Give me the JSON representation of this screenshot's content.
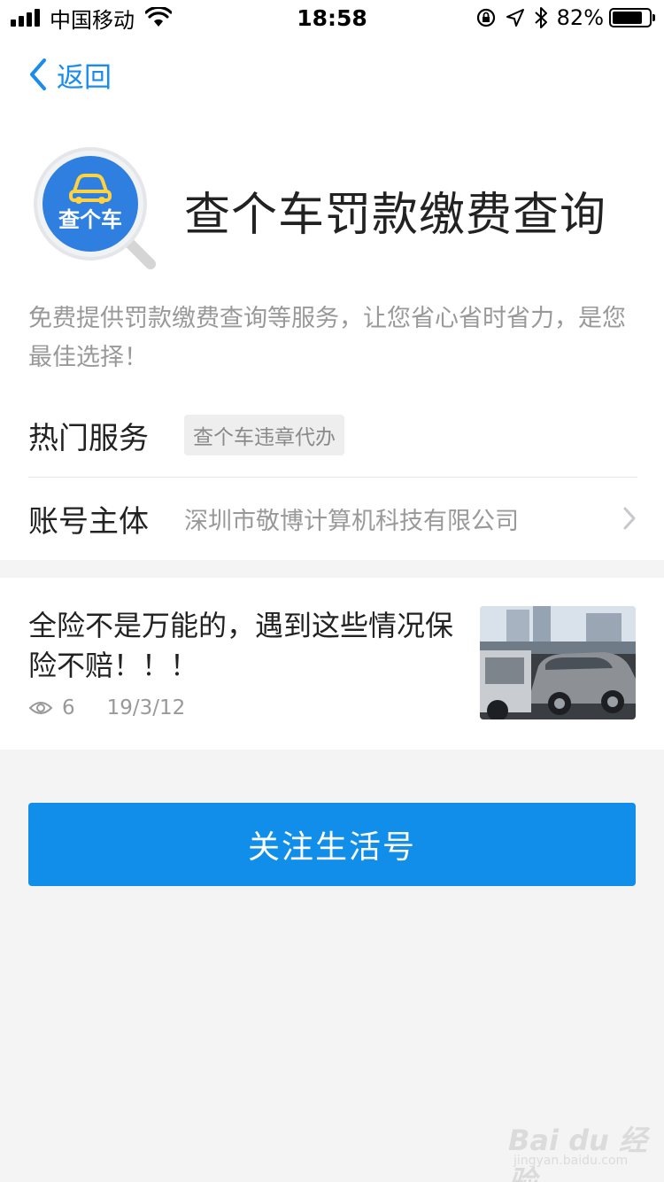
{
  "status_bar": {
    "carrier": "中国移动",
    "time": "18:58",
    "battery": "82%",
    "battery_level": 0.82
  },
  "nav": {
    "back_label": "返回"
  },
  "header": {
    "logo_text": "查个车",
    "title": "查个车罚款缴费查询",
    "description": "免费提供罚款缴费查询等服务，让您省心省时省力，是您最佳选择！"
  },
  "hot_services": {
    "label": "热门服务",
    "tag": "查个车违章代办"
  },
  "account": {
    "label": "账号主体",
    "value": "深圳市敬博计算机科技有限公司"
  },
  "article": {
    "title": "全险不是万能的，遇到这些情况保险不赔！！！",
    "views": "6",
    "date": "19/3/12"
  },
  "follow_button": "关注生活号",
  "watermark": {
    "text": "Bai du 经验",
    "url": "jingyan.baidu.com"
  },
  "colors": {
    "accent": "#108ee9",
    "link": "#1a8cee",
    "logo_blue": "#2f7fe0"
  }
}
